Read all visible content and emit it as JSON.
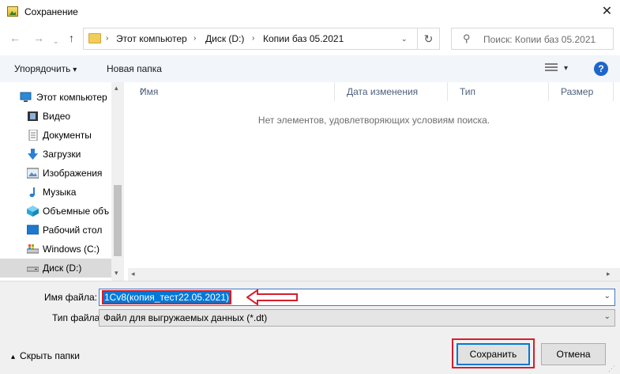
{
  "window": {
    "title": "Сохранение",
    "close_symbol": "✕"
  },
  "navigation": {
    "back_symbol": "←",
    "forward_symbol": "→",
    "history_symbol": "⌄",
    "up_symbol": "↑",
    "breadcrumbs": [
      "Этот компьютер",
      "Диск (D:)",
      "Копии баз 05.2021"
    ],
    "breadcrumb_separator": "›",
    "address_dropdown_symbol": "⌄",
    "refresh_symbol": "↻",
    "search_placeholder": "Поиск: Копии баз 05.2021",
    "search_symbol": "⚲"
  },
  "toolbar": {
    "organize_label": "Упорядочить",
    "new_folder_label": "Новая папка",
    "view_dropdown_symbol": "▾",
    "help_symbol": "?"
  },
  "sidebar": {
    "items": [
      {
        "label": "Этот компьютер",
        "icon": "computer-icon",
        "selected": false
      },
      {
        "label": "Видео",
        "icon": "video-icon",
        "selected": false
      },
      {
        "label": "Документы",
        "icon": "documents-icon",
        "selected": false
      },
      {
        "label": "Загрузки",
        "icon": "download-icon",
        "selected": false
      },
      {
        "label": "Изображения",
        "icon": "images-icon",
        "selected": false
      },
      {
        "label": "Музыка",
        "icon": "music-icon",
        "selected": false
      },
      {
        "label": "Объемные объ",
        "icon": "3d-objects-icon",
        "selected": false
      },
      {
        "label": "Рабочий стол",
        "icon": "desktop-icon",
        "selected": false
      },
      {
        "label": "Windows (C:)",
        "icon": "drive-icon",
        "selected": false
      },
      {
        "label": "Диск (D:)",
        "icon": "drive-icon",
        "selected": true
      }
    ],
    "scroll_up_symbol": "▴",
    "scroll_down_symbol": "▾"
  },
  "file_list": {
    "columns": [
      "Имя",
      "Дата изменения",
      "Тип",
      "Размер"
    ],
    "sort_symbol": "^",
    "empty_message": "Нет элементов, удовлетворяющих условиям поиска.",
    "scroll_left_symbol": "◂",
    "scroll_right_symbol": "▸"
  },
  "form": {
    "filename_label": "Имя файла:",
    "filename_value": "1Cv8(копия_тест22.05.2021)",
    "filetype_label": "Тип файла:",
    "filetype_value": "Файл для выгружаемых данных (*.dt)",
    "dropdown_symbol": "⌄",
    "hide_folders_label": "Скрыть папки",
    "save_label": "Сохранить",
    "cancel_label": "Отмена"
  },
  "colors": {
    "accent": "#0078d7",
    "annotation_red": "#d51e2c",
    "toolbar_bg": "#f2f5fa",
    "footer_bg": "#f0f0f0"
  }
}
